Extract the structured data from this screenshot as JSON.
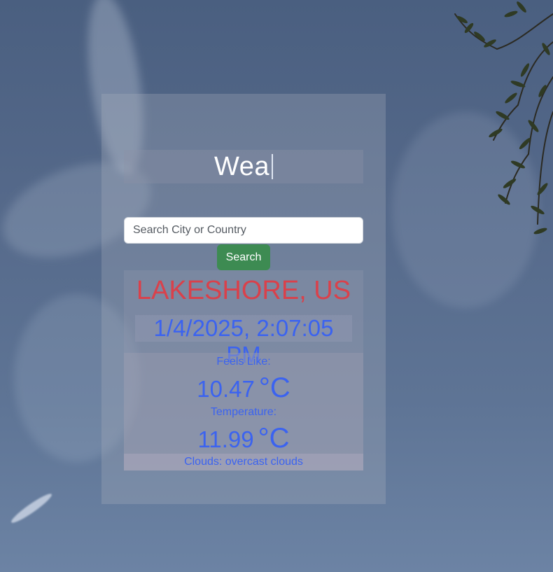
{
  "app": {
    "title_typed": "Wea"
  },
  "search": {
    "placeholder": "Search City or Country",
    "value": "",
    "button_label": "Search"
  },
  "weather": {
    "location": "LAKESHORE, US",
    "datetime": "1/4/2025, 2:07:05 PM",
    "feels_like_label": "Feels Like:",
    "feels_like_value": "10.47",
    "temperature_label": "Temperature:",
    "temperature_value": "11.99",
    "unit": "°C",
    "clouds": "Clouds: overcast clouds"
  },
  "colors": {
    "location": "#d9414b",
    "detail_text": "#3b63f0",
    "search_button": "#3d8b52",
    "title_text": "#ffffff"
  },
  "icons": {
    "background": "sky-with-tree-branches"
  }
}
